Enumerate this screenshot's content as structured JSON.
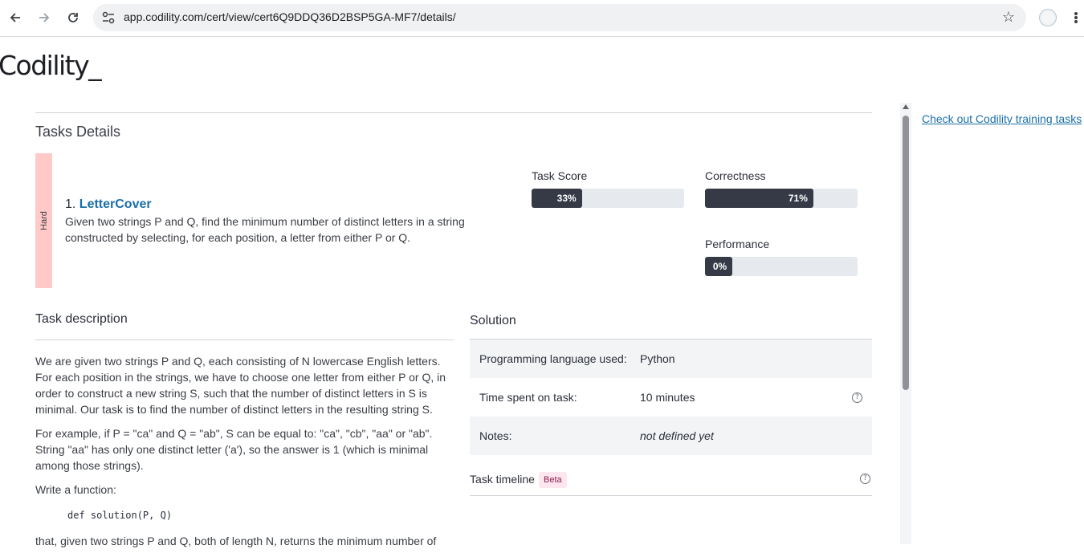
{
  "browser": {
    "url": "app.codility.com/cert/view/cert6Q9DDQ36D2BSP5GA-MF7/details/"
  },
  "logo": "Codility_",
  "page": {
    "heading": "Tasks Details",
    "side_link": "Check out Codility training tasks"
  },
  "task": {
    "difficulty": "Hard",
    "number": "1.",
    "name": "LetterCover",
    "summary": "Given two strings P and Q, find the minimum number of distinct letters in a string constructed by selecting, for each position, a letter from either P or Q."
  },
  "metrics": {
    "task_score": {
      "label": "Task Score",
      "value": 33,
      "display": "33%"
    },
    "correctness": {
      "label": "Correctness",
      "value": 71,
      "display": "71%"
    },
    "performance": {
      "label": "Performance",
      "value": 0,
      "display": "0%"
    }
  },
  "description": {
    "title": "Task description",
    "p1": "We are given two strings P and Q, each consisting of N lowercase English letters. For each position in the strings, we have to choose one letter from either P or Q, in order to construct a new string S, such that the number of distinct letters in S is minimal. Our task is to find the number of distinct letters in the resulting string S.",
    "p2": "For example, if P = \"ca\" and Q = \"ab\", S can be equal to: \"ca\", \"cb\", \"aa\" or \"ab\". String \"aa\" has only one distinct letter ('a'), so the answer is 1 (which is minimal among those strings).",
    "p3": "Write a function:",
    "code": "def solution(P, Q)",
    "p4": "that, given two strings P and Q, both of length N, returns the minimum number of"
  },
  "solution": {
    "title": "Solution",
    "rows": [
      {
        "key": "Programming language used:",
        "value": "Python"
      },
      {
        "key": "Time spent on task:",
        "value": "10 minutes"
      },
      {
        "key": "Notes:",
        "value": "not defined yet"
      }
    ],
    "timeline_label": "Task timeline",
    "beta_badge": "Beta"
  }
}
